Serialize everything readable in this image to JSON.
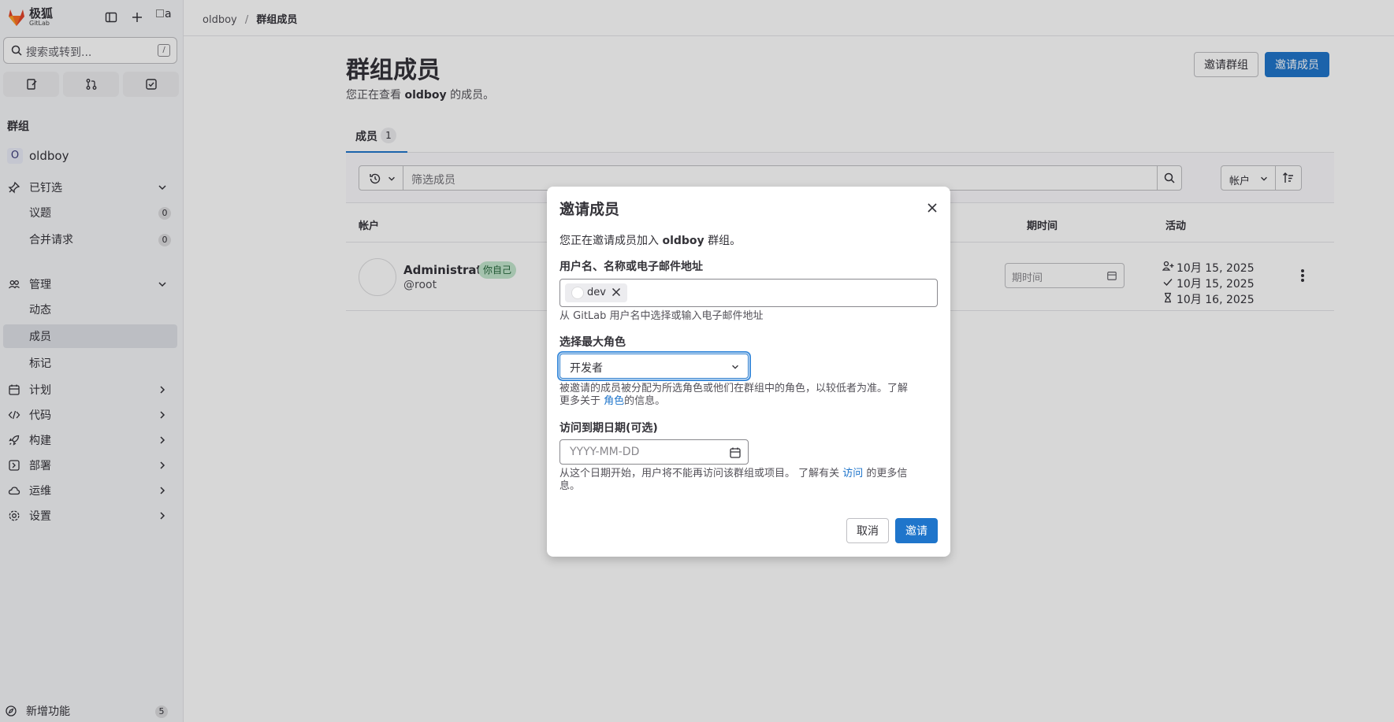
{
  "app": {
    "logo_text": "极狐",
    "logo_sub": "GitLab",
    "avatar_alt": "a"
  },
  "search": {
    "placeholder": "搜索或转到...",
    "shortcut": "/"
  },
  "sidebar": {
    "section": "群组",
    "group": {
      "initial": "O",
      "name": "oldboy"
    },
    "pinned": {
      "label": "已钉选",
      "items": [
        {
          "label": "议题",
          "count": "0"
        },
        {
          "label": "合并请求",
          "count": "0"
        }
      ]
    },
    "manage": {
      "label": "管理",
      "items": [
        {
          "label": "动态"
        },
        {
          "label": "成员"
        },
        {
          "label": "标记"
        }
      ]
    },
    "nav": [
      {
        "label": "计划"
      },
      {
        "label": "代码"
      },
      {
        "label": "构建"
      },
      {
        "label": "部署"
      },
      {
        "label": "运维"
      },
      {
        "label": "设置"
      }
    ],
    "whats_new": {
      "label": "新增功能",
      "count": "5"
    }
  },
  "breadcrumb": {
    "parent": "oldboy",
    "sep": "/",
    "current": "群组成员"
  },
  "page": {
    "title": "群组成员",
    "desc_prefix": "您正在查看 ",
    "desc_group": "oldboy",
    "desc_suffix": " 的成员。",
    "invite_group": "邀请群组",
    "invite_members": "邀请成员"
  },
  "tabs": [
    {
      "label": "成员",
      "count": "1"
    }
  ],
  "filter": {
    "placeholder": "筛选成员",
    "sort_label": "帐户"
  },
  "table": {
    "headers": {
      "account": "帐户",
      "expiry": "期时间",
      "activity": "活动"
    },
    "rows": [
      {
        "name": "Administrator",
        "you_badge": "你自己",
        "handle": "@root",
        "expiry_placeholder": "期时间",
        "activity": [
          "10月 15, 2025",
          "10月 15, 2025",
          "10月 16, 2025"
        ]
      }
    ]
  },
  "modal": {
    "title": "邀请成员",
    "intro_prefix": "您正在邀请成员加入 ",
    "intro_group": "oldboy",
    "intro_suffix": " 群组。",
    "user_label": "用户名、名称或电子邮件地址",
    "token": "dev",
    "user_help": "从 GitLab 用户名中选择或输入电子邮件地址",
    "role_label": "选择最大角色",
    "role_value": "开发者",
    "role_help_1": "被邀请的成员被分配为所选角色或他们在群组中的角色，以较低者为准。了解",
    "role_help_2": "更多关于 ",
    "role_help_link": "角色",
    "role_help_3": "的信息。",
    "expiry_label": "访问到期日期(可选)",
    "expiry_placeholder": "YYYY-MM-DD",
    "expiry_help_1": "从这个日期开始，用户将不能再访问该群组或项目。 了解有关 ",
    "expiry_help_link": "访问",
    "expiry_help_2": " 的更多信",
    "expiry_help_3": "息。",
    "cancel": "取消",
    "invite": "邀请"
  },
  "colors": {
    "primary": "#1f75cb",
    "sidebar_bg": "#f5f6f8",
    "badge_you": "#c3e6cd"
  }
}
